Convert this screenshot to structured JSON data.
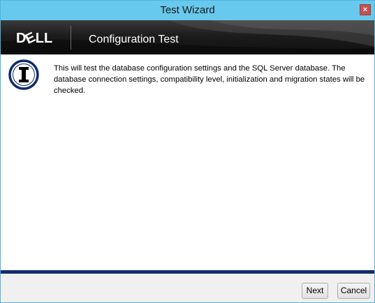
{
  "window": {
    "title": "Test Wizard",
    "close_glyph": "×"
  },
  "banner": {
    "logo_text": "DELL",
    "title": "Configuration Test"
  },
  "content": {
    "icon": "info-icon",
    "message": "This will test the database configuration settings and the SQL Server database. The database connection settings, compatibility level, initialization and migration states will be checked."
  },
  "footer": {
    "next_label": "Next",
    "cancel_label": "Cancel"
  },
  "colors": {
    "titlebar": "#67c9ed",
    "banner": "#1c1c1c",
    "progress_rule": "#0f2d6e",
    "close_button": "#c75050"
  }
}
